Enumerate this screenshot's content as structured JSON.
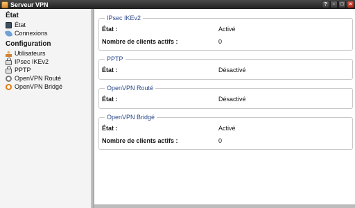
{
  "window": {
    "title": "Serveur VPN",
    "buttons": [
      "?",
      "-",
      "□",
      "×"
    ]
  },
  "sidebar": {
    "state_section": "État",
    "state_items": [
      {
        "label": "État",
        "icon": "monitor-icon"
      },
      {
        "label": "Connexions",
        "icon": "leaf-icon"
      }
    ],
    "config_section": "Configuration",
    "config_items": [
      {
        "label": "Utilisateurs",
        "icon": "user-icon"
      },
      {
        "label": "IPsec IKEv2",
        "icon": "lock-icon"
      },
      {
        "label": "PPTP",
        "icon": "lock-icon"
      },
      {
        "label": "OpenVPN Routé",
        "icon": "key-icon"
      },
      {
        "label": "OpenVPN Bridgé",
        "icon": "key-icon"
      }
    ]
  },
  "groups": {
    "ipsec": {
      "title": "IPsec IKEv2",
      "state_label": "État :",
      "state_value": "Activé",
      "clients_label": "Nombre de clients actifs :",
      "clients_value": "0"
    },
    "pptp": {
      "title": "PPTP",
      "state_label": "État :",
      "state_value": "Désactivé"
    },
    "openvpn_routed": {
      "title": "OpenVPN Routé",
      "state_label": "État :",
      "state_value": "Désactivé"
    },
    "openvpn_bridged": {
      "title": "OpenVPN Bridgé",
      "state_label": "État :",
      "state_value": "Activé",
      "clients_label": "Nombre de clients actifs :",
      "clients_value": "0"
    }
  }
}
